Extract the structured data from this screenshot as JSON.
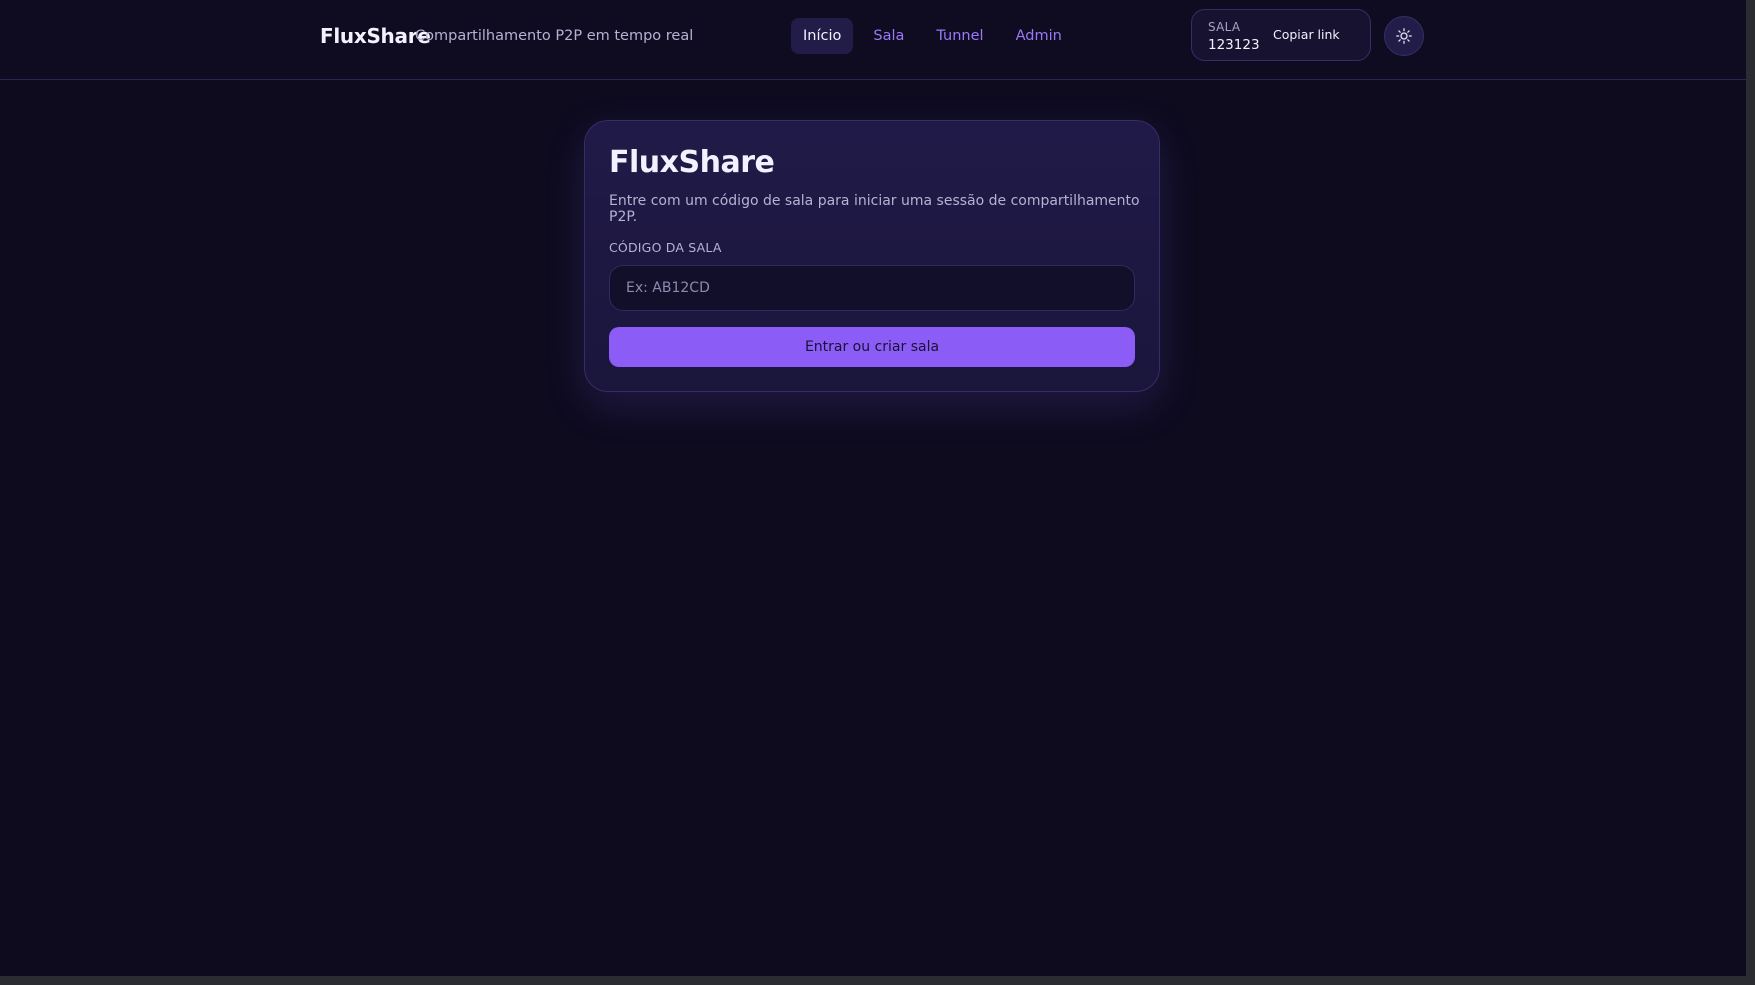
{
  "header": {
    "brand": "FluxShare",
    "tagline": "Compartilhamento P2P em tempo real",
    "nav": [
      {
        "label": "Início",
        "active": true
      },
      {
        "label": "Sala",
        "active": false
      },
      {
        "label": "Tunnel",
        "active": false
      },
      {
        "label": "Admin",
        "active": false
      }
    ],
    "room": {
      "label": "SALA",
      "code": "123123",
      "copy_label": "Copiar link"
    },
    "theme_toggle_icon": "sun-icon"
  },
  "card": {
    "title": "FluxShare",
    "description": "Entre com um código de sala para iniciar uma sessão de compartilhamento P2P.",
    "field_label": "CÓDIGO DA SALA",
    "input_value": "",
    "input_placeholder": "Ex: AB12CD",
    "submit_label": "Entrar ou criar sala"
  },
  "colors": {
    "background": "#0e0b1f",
    "accent": "#8b5cf6",
    "nav_link": "#9a78f6"
  }
}
